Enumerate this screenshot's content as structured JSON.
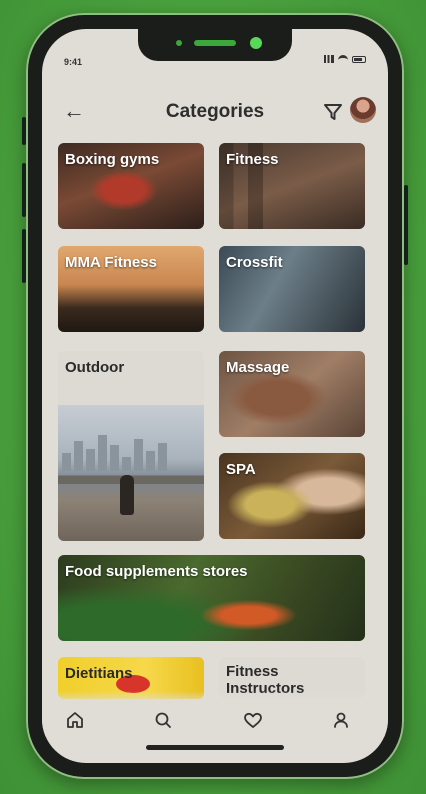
{
  "status_bar": {
    "time": "9:41"
  },
  "header": {
    "title": "Categories"
  },
  "categories": [
    {
      "id": "boxing",
      "label": "Boxing gyms"
    },
    {
      "id": "fitness",
      "label": "Fitness"
    },
    {
      "id": "mma",
      "label": "MMA Fitness"
    },
    {
      "id": "crossfit",
      "label": "Crossfit"
    },
    {
      "id": "outdoor",
      "label": "Outdoor"
    },
    {
      "id": "massage",
      "label": "Massage"
    },
    {
      "id": "spa",
      "label": "SPA"
    },
    {
      "id": "food",
      "label": "Food supplements stores"
    },
    {
      "id": "diet",
      "label": "Dietitians"
    },
    {
      "id": "instructors",
      "label": "Fitness Instructors"
    }
  ],
  "tabbar": {
    "items": [
      "home-icon",
      "search-icon",
      "heart-icon",
      "profile-icon"
    ]
  },
  "colors": {
    "background": "#4aa23d",
    "screen": "#dfddd6",
    "accent_yellow": "#f0cf2a",
    "notch_green": "#5ad85a"
  }
}
